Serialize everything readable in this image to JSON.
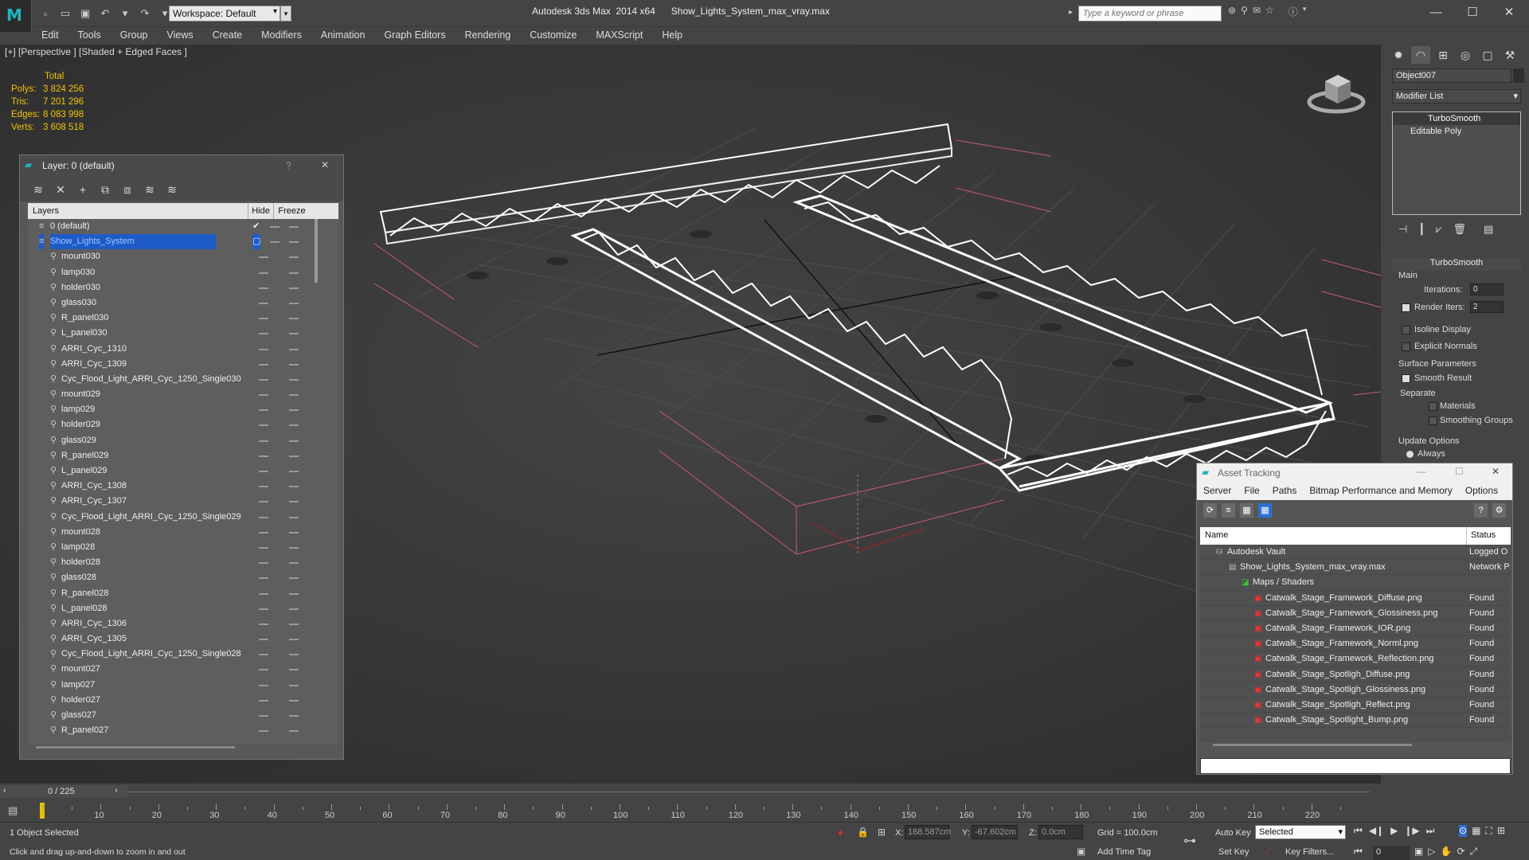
{
  "title_bar": {
    "app_name": "Autodesk 3ds Max  2014 x64",
    "file_name": "Show_Lights_System_max_vray.max",
    "workspace": "Workspace: Default",
    "search_placeholder": "Type a keyword or phrase"
  },
  "menu": [
    "Edit",
    "Tools",
    "Group",
    "Views",
    "Create",
    "Modifiers",
    "Animation",
    "Graph Editors",
    "Rendering",
    "Customize",
    "MAXScript",
    "Help"
  ],
  "viewport": {
    "label": "[+] [Perspective ] [Shaded + Edged Faces ]",
    "stats_header": "Total",
    "stats": [
      {
        "key": "Polys:",
        "value": "3 824 256"
      },
      {
        "key": "Tris:",
        "value": "7 201 296"
      },
      {
        "key": "Edges:",
        "value": "8 083 998"
      },
      {
        "key": "Verts:",
        "value": "3 608 518"
      }
    ]
  },
  "command_panel": {
    "object_name": "Object007",
    "modifier_list": "Modifier List",
    "stack": [
      "TurboSmooth",
      "Editable Poly"
    ],
    "rollout_title": "TurboSmooth",
    "main_label": "Main",
    "iterations_label": "Iterations:",
    "iterations_value": "0",
    "render_iters_label": "Render Iters:",
    "render_iters_value": "2",
    "isoline": "Isoline Display",
    "explicit_normals": "Explicit Normals",
    "surface_params": "Surface Parameters",
    "smooth_result": "Smooth Result",
    "separate": "Separate",
    "materials": "Materials",
    "smoothing_groups": "Smoothing Groups",
    "update_options": "Update Options",
    "always": "Always"
  },
  "layer_panel": {
    "title": "Layer: 0 (default)",
    "help": "?",
    "col_layers": "Layers",
    "col_hide": "Hide",
    "col_freeze": "Freeze",
    "rows": [
      {
        "name": "0 (default)",
        "indent": 1
      },
      {
        "name": "Show_Lights_System",
        "indent": 1
      },
      {
        "name": "mount030",
        "indent": 2
      },
      {
        "name": "lamp030",
        "indent": 2
      },
      {
        "name": "holder030",
        "indent": 2
      },
      {
        "name": "glass030",
        "indent": 2
      },
      {
        "name": "R_panel030",
        "indent": 2
      },
      {
        "name": "L_panel030",
        "indent": 2
      },
      {
        "name": "ARRI_Cyc_1310",
        "indent": 2
      },
      {
        "name": "ARRI_Cyc_1309",
        "indent": 2
      },
      {
        "name": "Cyc_Flood_Light_ARRI_Cyc_1250_Single030",
        "indent": 2
      },
      {
        "name": "mount029",
        "indent": 2
      },
      {
        "name": "lamp029",
        "indent": 2
      },
      {
        "name": "holder029",
        "indent": 2
      },
      {
        "name": "glass029",
        "indent": 2
      },
      {
        "name": "R_panel029",
        "indent": 2
      },
      {
        "name": "L_panel029",
        "indent": 2
      },
      {
        "name": "ARRI_Cyc_1308",
        "indent": 2
      },
      {
        "name": "ARRI_Cyc_1307",
        "indent": 2
      },
      {
        "name": "Cyc_Flood_Light_ARRI_Cyc_1250_Single029",
        "indent": 2
      },
      {
        "name": "mount028",
        "indent": 2
      },
      {
        "name": "lamp028",
        "indent": 2
      },
      {
        "name": "holder028",
        "indent": 2
      },
      {
        "name": "glass028",
        "indent": 2
      },
      {
        "name": "R_panel028",
        "indent": 2
      },
      {
        "name": "L_panel028",
        "indent": 2
      },
      {
        "name": "ARRI_Cyc_1306",
        "indent": 2
      },
      {
        "name": "ARRI_Cyc_1305",
        "indent": 2
      },
      {
        "name": "Cyc_Flood_Light_ARRI_Cyc_1250_Single028",
        "indent": 2
      },
      {
        "name": "mount027",
        "indent": 2
      },
      {
        "name": "lamp027",
        "indent": 2
      },
      {
        "name": "holder027",
        "indent": 2
      },
      {
        "name": "glass027",
        "indent": 2
      },
      {
        "name": "R_panel027",
        "indent": 2
      }
    ]
  },
  "asset_tracking": {
    "title": "Asset Tracking",
    "menu": [
      "Server",
      "File",
      "Paths",
      "Bitmap Performance and Memory",
      "Options"
    ],
    "col_name": "Name",
    "col_status": "Status",
    "rows": [
      {
        "name": "Autodesk Vault",
        "status": "Logged O",
        "indent": 0
      },
      {
        "name": "Show_Lights_System_max_vray.max",
        "status": "Network P",
        "indent": 1
      },
      {
        "name": "Maps / Shaders",
        "status": "",
        "indent": 2
      },
      {
        "name": "Catwalk_Stage_Framework_Diffuse.png",
        "status": "Found",
        "indent": 3
      },
      {
        "name": "Catwalk_Stage_Framework_Glossiness.png",
        "status": "Found",
        "indent": 3
      },
      {
        "name": "Catwalk_Stage_Framework_IOR.png",
        "status": "Found",
        "indent": 3
      },
      {
        "name": "Catwalk_Stage_Framework_Norml.png",
        "status": "Found",
        "indent": 3
      },
      {
        "name": "Catwalk_Stage_Framework_Reflection.png",
        "status": "Found",
        "indent": 3
      },
      {
        "name": "Catwalk_Stage_Spotligh_Diffuse.png",
        "status": "Found",
        "indent": 3
      },
      {
        "name": "Catwalk_Stage_Spotligh_Glossiness.png",
        "status": "Found",
        "indent": 3
      },
      {
        "name": "Catwalk_Stage_Spotligh_Reflect.png",
        "status": "Found",
        "indent": 3
      },
      {
        "name": "Catwalk_Stage_Spotlight_Bump.png",
        "status": "Found",
        "indent": 3
      }
    ]
  },
  "timeline": {
    "frame_counter": "0 / 225",
    "ticks": [
      "10",
      "20",
      "30",
      "40",
      "50",
      "60",
      "70",
      "80",
      "90",
      "100",
      "110",
      "120",
      "130",
      "140",
      "150",
      "160",
      "170",
      "180",
      "190",
      "200",
      "210",
      "220"
    ]
  },
  "status_bar": {
    "selection": "1 Object Selected",
    "prompt": "Click and drag up-and-down to zoom in and out",
    "x_label": "X:",
    "x_value": "168.587cm",
    "y_label": "Y:",
    "y_value": "-67.602cm",
    "z_label": "Z:",
    "z_value": "0.0cm",
    "grid": "Grid = 100.0cm",
    "add_time_tag": "Add Time Tag",
    "auto_key": "Auto Key",
    "set_key": "Set Key",
    "selected_option": "Selected",
    "key_filters": "Key Filters...",
    "current_frame": "0"
  }
}
